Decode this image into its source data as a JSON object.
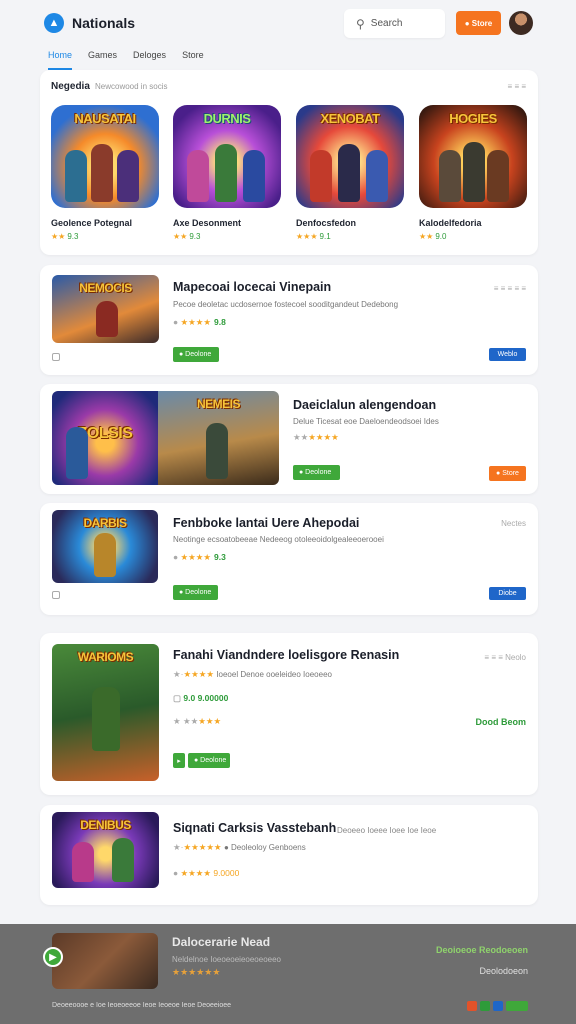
{
  "header": {
    "brand": "Nationals",
    "search_placeholder": "Search",
    "cta_label": "● Store",
    "search_icon": "search-icon",
    "colors": {
      "accent": "#1e88e5",
      "cta": "#f5741f"
    }
  },
  "tabs": [
    {
      "label": "Home",
      "active": true
    },
    {
      "label": "Games"
    },
    {
      "label": "Deloges"
    },
    {
      "label": "Store"
    }
  ],
  "featured": {
    "title": "Negedia",
    "subtitle": "Newcowood in socis",
    "more": "≡ ≡ ≡",
    "items": [
      {
        "art": "NAUSATAI",
        "name": "Geolence Potegnal",
        "stars": "★★",
        "score": "9.3"
      },
      {
        "art": "DURNIS",
        "name": "Axe Desonment",
        "stars": "★★",
        "score": "9.3"
      },
      {
        "art": "XENOBAT",
        "name": "Denfocsfedon",
        "stars": "★★★",
        "score": "9.1"
      },
      {
        "art": "HOGIES",
        "name": "Kalodelfedoria",
        "stars": "★★",
        "score": "9.0"
      }
    ]
  },
  "cards": [
    {
      "art": "NEMOCIS",
      "title": "Mapecoai locecai Vinepain",
      "desc": "Pecoe deoletac ucdosernoe fostecoel sooditgandeut Dedebong",
      "stars": "★★★★",
      "score": "9.8",
      "tag": "≡ ≡ ≡ ≡ ≡",
      "button": "● Deolone",
      "side": "Weblo"
    },
    {
      "art": "ZOLSIS",
      "art2": "NEMEIS",
      "title": "Daeiclalun alengendoan",
      "desc": "Delue Ticesat eoe Daeloendeodsoei Ides",
      "stars": "★★★★",
      "score": "",
      "tag": "",
      "button": "● Deolone",
      "side": "● Store"
    },
    {
      "art": "DARBIS",
      "title": "Fenbboke lantai Uere Ahepodai",
      "desc": "Neotinge ecsoatobeeae Nedeeog otoleeoidolgealeeoerooei",
      "stars": "★★★★",
      "score": "9.3",
      "tag": "Nectes",
      "button": "● Deolone",
      "side": "Diobe"
    },
    {
      "art": "WARIOMS",
      "title": "Fanahi Viandndere loelisgore Renasin",
      "desc": "Ioeoel Denoe ooeleideo Ioeoeeo",
      "stars": "★★★★",
      "score": "",
      "subscore": "9.0 9.00000",
      "stars2": "★★★",
      "tag": "≡ ≡ ≡ Neolo",
      "button": "● Deolone",
      "side": "Dood Beom"
    },
    {
      "art": "DENIBUS",
      "title": "Siqnati Carksis Vasstebanh",
      "desc": "● Deoleoloy Genboens",
      "stars": "★★★★★",
      "score": "",
      "subscore": "★★★★ 9.0000",
      "tag": "Deoeeo Ioeee Ioee Ioe Ieoe",
      "button": "",
      "side": ""
    }
  ],
  "bottom": {
    "title": "Dalocerarie Nead",
    "desc": "Neldelnoe Ioeoeoeieoeoeoeeo",
    "stars": "★★★★★★",
    "right1": "Deoioeoe Reodoeoen",
    "right2": "Deolodoeon",
    "footer": "Deoeeoooe e Ioe Ieoeoeeoe Ieoe Ieoeoe Ieoe Deoeeioee"
  }
}
